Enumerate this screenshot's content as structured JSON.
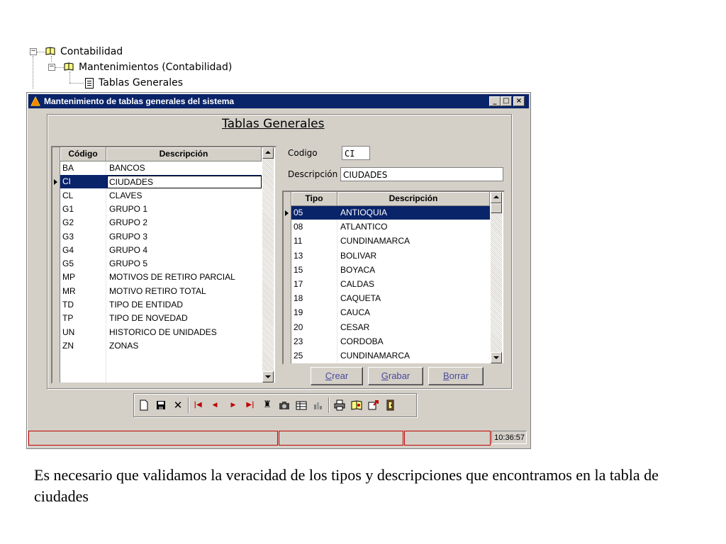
{
  "tree": {
    "root": "Contabilidad",
    "child": "Mantenimientos (Contabilidad)",
    "leaf": "Tablas Generales"
  },
  "window": {
    "title": "Mantenimiento de tablas generales del sistema",
    "form_title": "Tablas Generales"
  },
  "left_grid": {
    "headers": [
      "Código",
      "Descripción"
    ],
    "rows": [
      {
        "code": "BA",
        "desc": "BANCOS"
      },
      {
        "code": "CI",
        "desc": "CIUDADES"
      },
      {
        "code": "CL",
        "desc": "CLAVES"
      },
      {
        "code": "G1",
        "desc": "GRUPO 1"
      },
      {
        "code": "G2",
        "desc": "GRUPO 2"
      },
      {
        "code": "G3",
        "desc": "GRUPO 3"
      },
      {
        "code": "G4",
        "desc": "GRUPO 4"
      },
      {
        "code": "G5",
        "desc": "GRUPO 5"
      },
      {
        "code": "MP",
        "desc": "MOTIVOS DE RETIRO PARCIAL"
      },
      {
        "code": "MR",
        "desc": "MOTIVO RETIRO TOTAL"
      },
      {
        "code": "TD",
        "desc": "TIPO DE ENTIDAD"
      },
      {
        "code": "TP",
        "desc": "TIPO DE NOVEDAD"
      },
      {
        "code": "UN",
        "desc": "HISTORICO DE UNIDADES"
      },
      {
        "code": "ZN",
        "desc": "ZONAS"
      }
    ]
  },
  "form": {
    "codigo_label": "Codigo",
    "codigo_value": "CI",
    "descripcion_label": "Descripción",
    "descripcion_value": "CIUDADES"
  },
  "right_grid": {
    "headers": [
      "Tipo",
      "Descripción"
    ],
    "rows": [
      {
        "tipo": "05",
        "desc": "ANTIOQUIA"
      },
      {
        "tipo": "08",
        "desc": "ATLANTICO"
      },
      {
        "tipo": "11",
        "desc": "CUNDINAMARCA"
      },
      {
        "tipo": "13",
        "desc": "BOLIVAR"
      },
      {
        "tipo": "15",
        "desc": "BOYACA"
      },
      {
        "tipo": "17",
        "desc": "CALDAS"
      },
      {
        "tipo": "18",
        "desc": "CAQUETA"
      },
      {
        "tipo": "19",
        "desc": "CAUCA"
      },
      {
        "tipo": "20",
        "desc": "CESAR"
      },
      {
        "tipo": "23",
        "desc": "CORDOBA"
      },
      {
        "tipo": "25",
        "desc": "CUNDINAMARCA"
      }
    ]
  },
  "buttons": {
    "crear_first": "C",
    "crear_rest": "rear",
    "grabar_first": "G",
    "grabar_rest": "rabar",
    "borrar_first": "B",
    "borrar_rest": "orrar"
  },
  "toolbar_icons": [
    "new-icon",
    "save-icon",
    "delete-icon",
    "first-icon",
    "prev-icon",
    "next-icon",
    "last-icon",
    "find-icon",
    "camera-icon",
    "grid-icon",
    "chart-icon",
    "print-icon",
    "book-icon",
    "export-icon",
    "exit-icon"
  ],
  "status": {
    "time": "10:36:57"
  },
  "caption": "Es necesario que validamos la veracidad de los tipos y descripciones que encontramos en la tabla de ciudades",
  "colors": {
    "titlebar": "#0a246a",
    "selection": "#0a246a",
    "face": "#d4d0c8"
  }
}
